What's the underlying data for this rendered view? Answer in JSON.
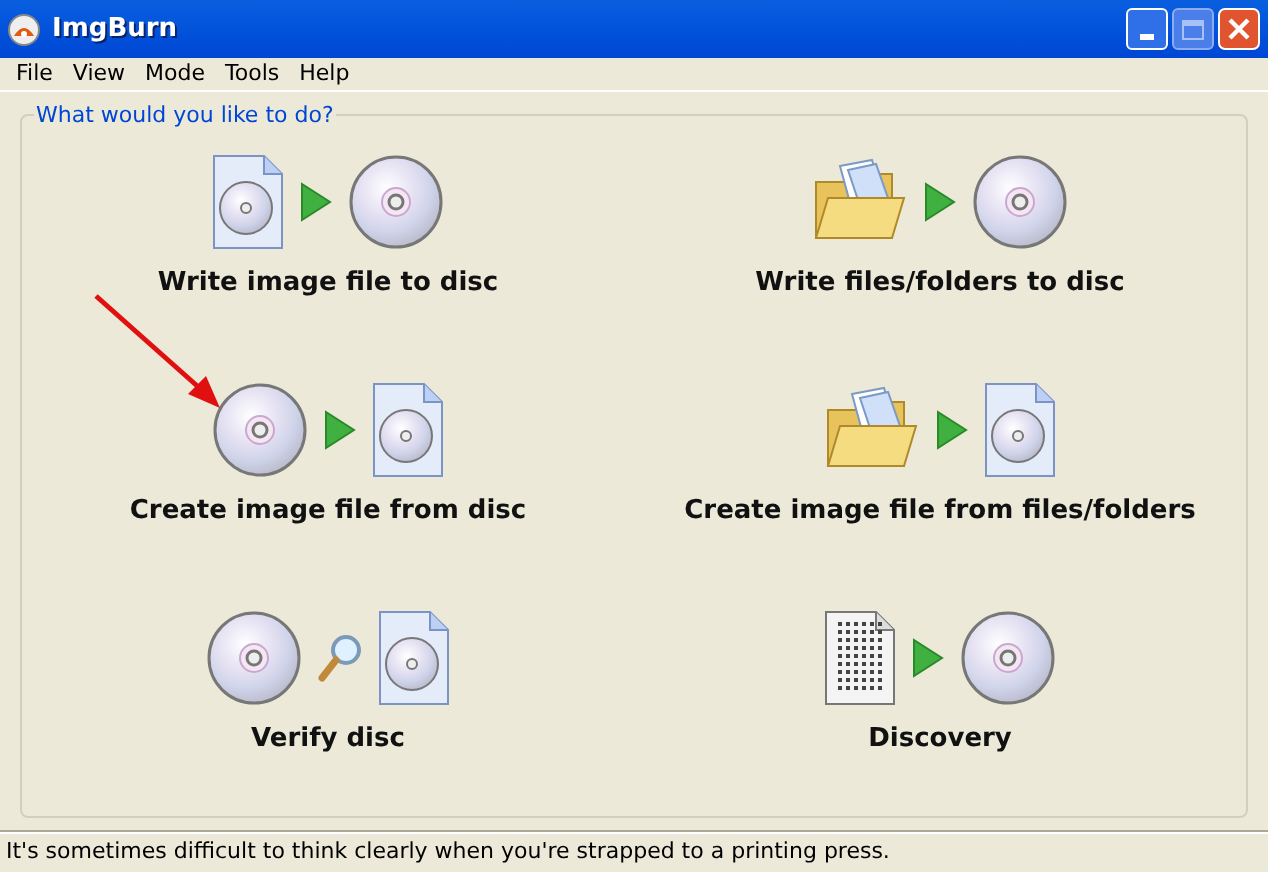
{
  "window": {
    "title": "ImgBurn"
  },
  "menu": [
    "File",
    "View",
    "Mode",
    "Tools",
    "Help"
  ],
  "group": {
    "title": "What would you like to do?"
  },
  "actions": [
    {
      "label": "Write image file to disc",
      "kind": "write-image"
    },
    {
      "label": "Write files/folders to disc",
      "kind": "write-files"
    },
    {
      "label": "Create image file from disc",
      "kind": "create-image"
    },
    {
      "label": "Create image file from files/folders",
      "kind": "create-from-files"
    },
    {
      "label": "Verify disc",
      "kind": "verify"
    },
    {
      "label": "Discovery",
      "kind": "discovery"
    }
  ],
  "status_bar": {
    "text": "It's sometimes difficult to think clearly when you're strapped to a printing press."
  }
}
